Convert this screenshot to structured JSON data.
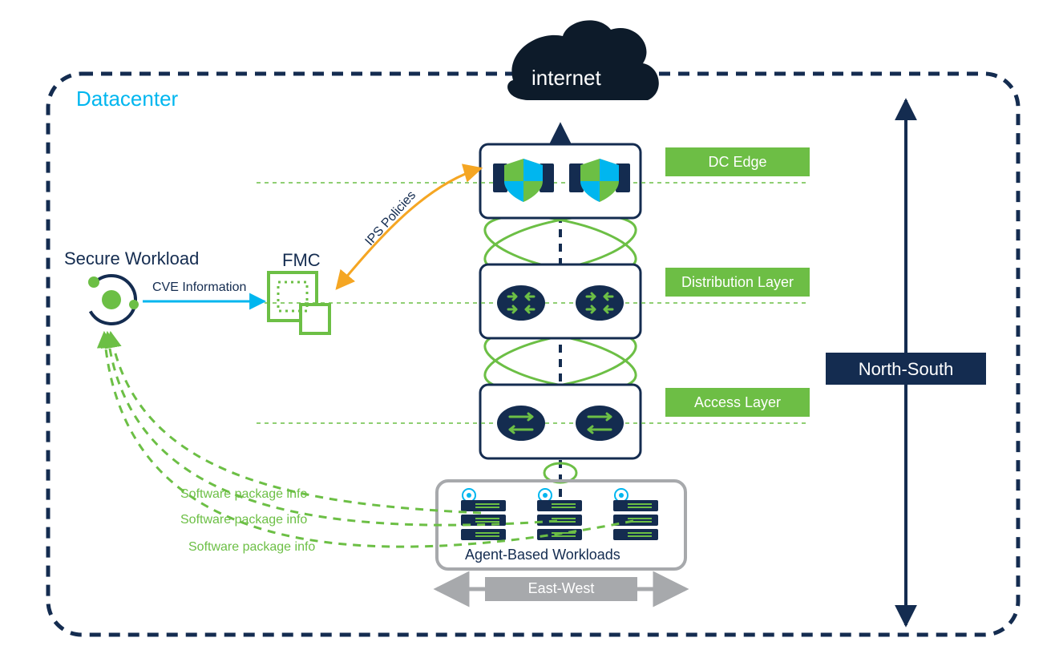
{
  "cloud_label": "internet",
  "frame_title": "Datacenter",
  "sw_label": "Secure Workload",
  "cve_label": "CVE Information",
  "fmc_label": "FMC",
  "ips_label": "IPS Policies",
  "layers": {
    "edge": "DC Edge",
    "dist": "Distribution Layer",
    "access": "Access Layer"
  },
  "workloads_label": "Agent-Based Workloads",
  "pkg1": "Software package info",
  "pkg2": "Software package info",
  "pkg3": "Software package info",
  "ns_label": "North-South",
  "ew_label": "East-West",
  "colors": {
    "navy": "#142c50",
    "cyan": "#00b6ef",
    "green": "#6cbf45",
    "gray": "#a7a9ac",
    "orange": "#f5a623"
  }
}
